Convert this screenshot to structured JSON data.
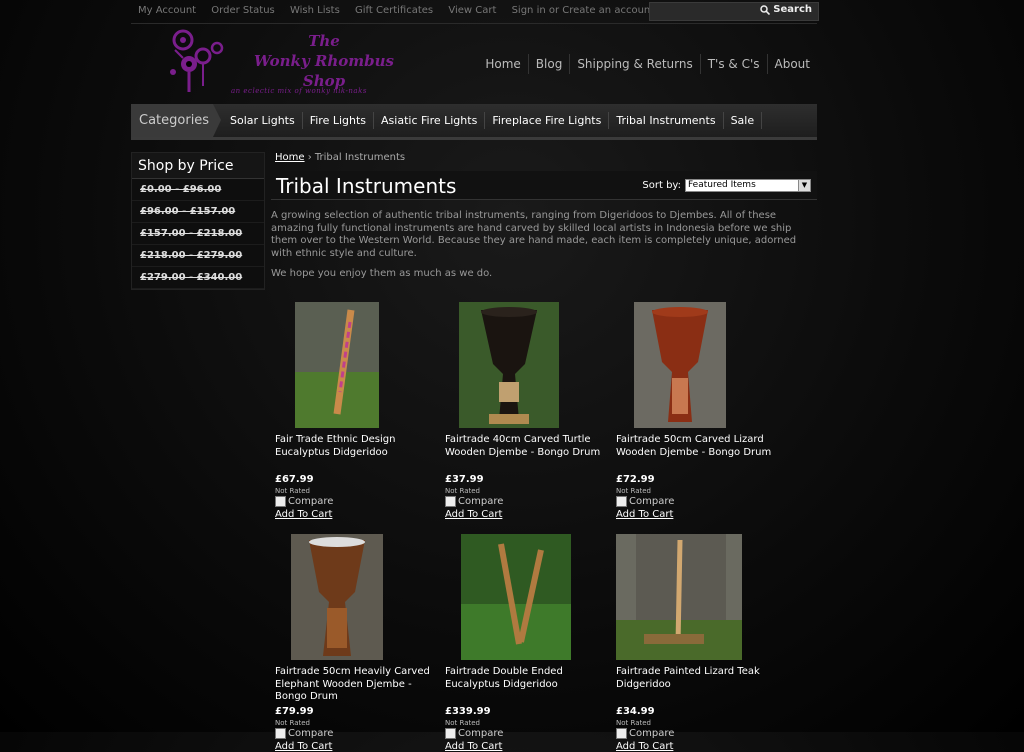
{
  "toplinks": [
    "My Account",
    "Order Status",
    "Wish Lists",
    "Gift Certificates",
    "View Cart",
    "Sign in or Create an account"
  ],
  "search": {
    "label": "Search",
    "placeholder": ""
  },
  "logo": {
    "line1": "The",
    "line2": "Wonky Rhombus",
    "line3": "Shop",
    "tagline": "an eclectic mix of wonky nik-naks"
  },
  "mainnav": [
    "Home",
    "Blog",
    "Shipping & Returns",
    "T's & C's",
    "About"
  ],
  "categories": {
    "label": "Categories",
    "items": [
      "Solar Lights",
      "Fire Lights",
      "Asiatic Fire Lights",
      "Fireplace Fire Lights",
      "Tribal Instruments",
      "Sale"
    ]
  },
  "sidebar": {
    "title": "Shop by Price",
    "items": [
      "£0.00 - £96.00",
      "£96.00 - £157.00",
      "£157.00 - £218.00",
      "£218.00 - £279.00",
      "£279.00 - £340.00"
    ]
  },
  "breadcrumb": {
    "home": "Home",
    "current": "Tribal Instruments"
  },
  "page": {
    "title": "Tribal Instruments",
    "sort_label": "Sort by:",
    "sort_value": "Featured Items",
    "desc1": "A growing selection of authentic tribal instruments, ranging from Digeridoos to Djembes. All of these amazing fully functional instruments are hand carved by skilled local artists in Indonesia before we ship them over to the Western World. Because they are hand made, each item is completely unique, adorned with ethnic style and culture.",
    "desc2": "We hope you enjoy them as much as we do."
  },
  "products": [
    {
      "name": "Fair Trade Ethnic Design Eucalyptus Didgeridoo",
      "price": "£67.99",
      "rating": "Not Rated",
      "compare": "Compare",
      "cart": "Add To Cart"
    },
    {
      "name": "Fairtrade 40cm Carved Turtle Wooden Djembe - Bongo Drum",
      "price": "£37.99",
      "rating": "Not Rated",
      "compare": "Compare",
      "cart": "Add To Cart"
    },
    {
      "name": "Fairtrade 50cm Carved Lizard Wooden Djembe - Bongo Drum",
      "price": "£72.99",
      "rating": "Not Rated",
      "compare": "Compare",
      "cart": "Add To Cart"
    },
    {
      "name": "Fairtrade 50cm Heavily Carved Elephant Wooden Djembe - Bongo Drum",
      "price": "£79.99",
      "rating": "Not Rated",
      "compare": "Compare",
      "cart": "Add To Cart"
    },
    {
      "name": "Fairtrade Double Ended Eucalyptus Didgeridoo",
      "price": "£339.99",
      "rating": "Not Rated",
      "compare": "Compare",
      "cart": "Add To Cart"
    },
    {
      "name": "Fairtrade Painted Lizard Teak Didgeridoo",
      "price": "£34.99",
      "rating": "Not Rated",
      "compare": "Compare",
      "cart": "Add To Cart"
    }
  ]
}
